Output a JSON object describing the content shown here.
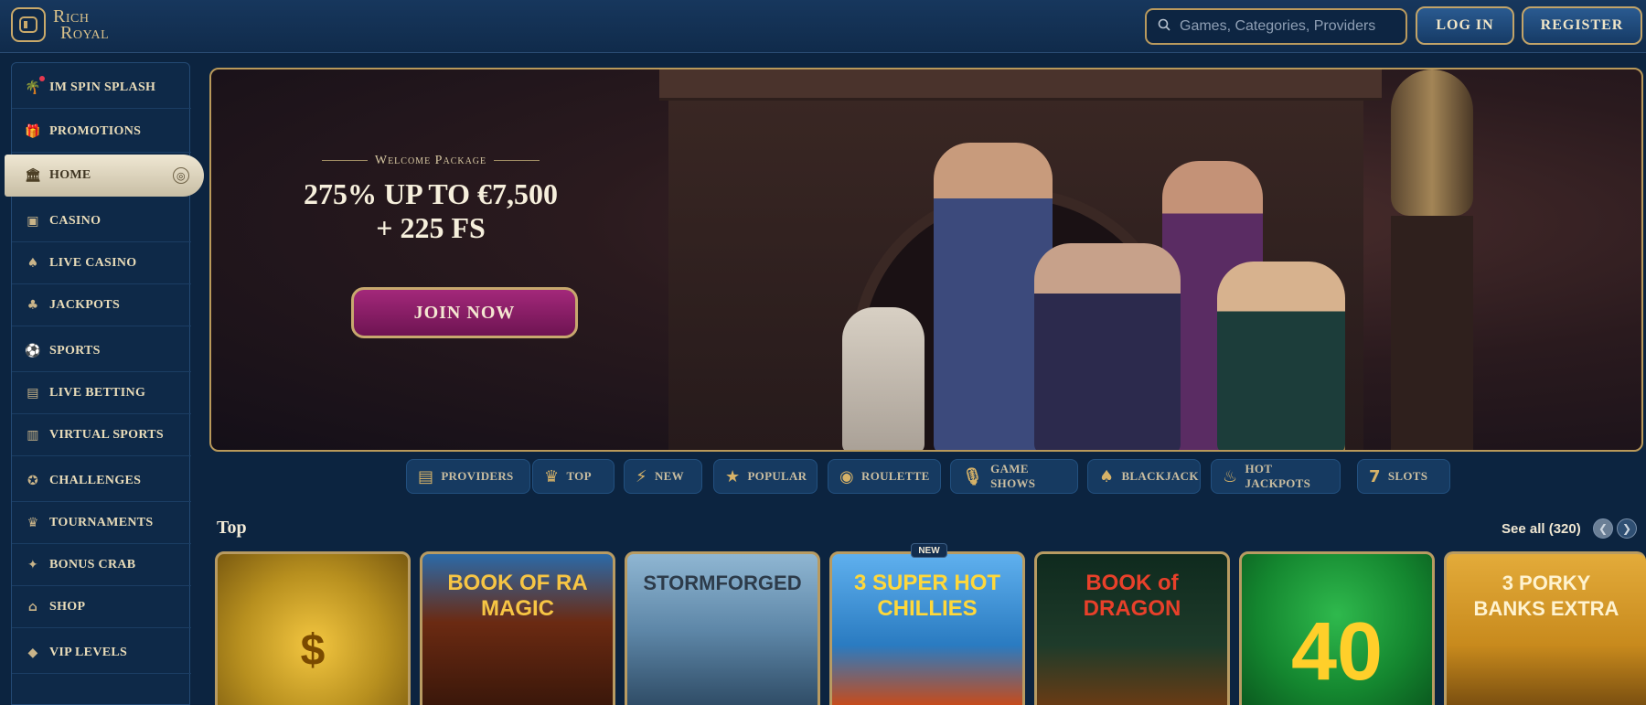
{
  "header": {
    "logo_line1": "Rich",
    "logo_line2": "Royal",
    "search_placeholder": "Games, Categories, Providers",
    "login_label": "LOG IN",
    "register_label": "REGISTER"
  },
  "sidebar": {
    "items": [
      {
        "label": "IM SPIN SPLASH",
        "icon": "palm-tree-icon",
        "glyph": "🌴"
      },
      {
        "label": "PROMOTIONS",
        "icon": "gift-icon",
        "glyph": "🎁"
      },
      {
        "label": "HOME",
        "icon": "bank-icon",
        "glyph": "🏛"
      },
      {
        "label": "CASINO",
        "icon": "slot-machine-icon",
        "glyph": "▣"
      },
      {
        "label": "LIVE CASINO",
        "icon": "cards-icon",
        "glyph": "♠"
      },
      {
        "label": "JACKPOTS",
        "icon": "clover-icon",
        "glyph": "♣"
      },
      {
        "label": "SPORTS",
        "icon": "ball-icon",
        "glyph": "⚽"
      },
      {
        "label": "LIVE BETTING",
        "icon": "live-screen-icon",
        "glyph": "▤"
      },
      {
        "label": "VIRTUAL SPORTS",
        "icon": "virtual-screen-icon",
        "glyph": "▥"
      },
      {
        "label": "CHALLENGES",
        "icon": "medal-icon",
        "glyph": "✪"
      },
      {
        "label": "TOURNAMENTS",
        "icon": "trophy-icon",
        "glyph": "♛"
      },
      {
        "label": "BONUS CRAB",
        "icon": "crab-icon",
        "glyph": "✦"
      },
      {
        "label": "SHOP",
        "icon": "basket-icon",
        "glyph": "⌂"
      },
      {
        "label": "VIP LEVELS",
        "icon": "diamond-icon",
        "glyph": "◆"
      }
    ]
  },
  "banner": {
    "subtitle": "Welcome Package",
    "title_line1": "275% UP TO €7,500",
    "title_line2": "+ 225 FS",
    "cta_label": "JOIN NOW"
  },
  "tabs": [
    {
      "label": "PROVIDERS",
      "glyph": "▤"
    },
    {
      "label": "TOP",
      "glyph": "♛"
    },
    {
      "label": "NEW",
      "glyph": "⚡"
    },
    {
      "label": "POPULAR",
      "glyph": "★"
    },
    {
      "label": "ROULETTE",
      "glyph": "◉"
    },
    {
      "label": "GAME SHOWS",
      "glyph": "🎙"
    },
    {
      "label": "BLACKJACK",
      "glyph": "♠"
    },
    {
      "label": "HOT JACKPOTS",
      "glyph": "♨"
    },
    {
      "label": "SLOTS",
      "glyph": "7"
    }
  ],
  "top_section": {
    "title": "Top",
    "see_all_label": "See all (320)",
    "new_badge": "NEW",
    "games": [
      {
        "title": "$",
        "bg": "#b8901f"
      },
      {
        "title": "BOOK OF RA MAGIC",
        "bg": "#6b2a12"
      },
      {
        "title": "STORMFORGED",
        "bg": "#5e87a8"
      },
      {
        "title": "3 SUPER HOT CHILLIES",
        "bg": "#2a7bc1"
      },
      {
        "title": "BOOK of DRAGON",
        "bg": "#1e3b2a"
      },
      {
        "title": "40",
        "bg": "#14862f"
      },
      {
        "title": "3 PORKY BANKS EXTRA",
        "bg": "#c88a1d"
      }
    ]
  },
  "colors": {
    "accent_gold": "#c9a96a",
    "cta_purple": "#a3287a",
    "page_bg": "#0c2440"
  }
}
